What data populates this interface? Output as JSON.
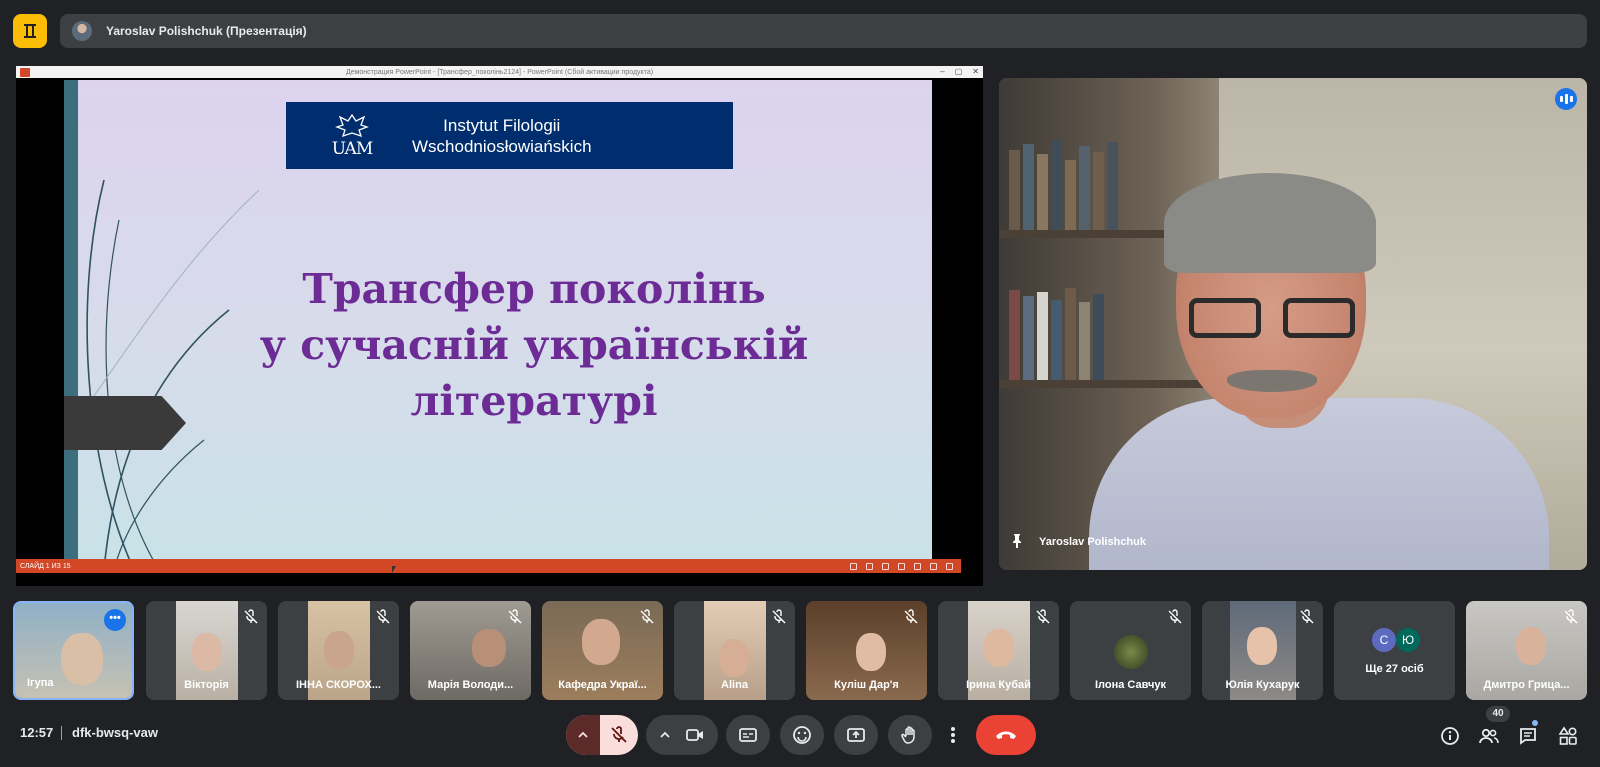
{
  "topbar": {
    "presenter_title": "Yaroslav Polishchuk (Презентація)"
  },
  "presentation": {
    "window_title": "Демонстрация PowerPoint - [Трансфер_поколінь2124] - PowerPoint (Сбой активации продукта)",
    "banner": {
      "logo_text": "UAM",
      "line1": "Instytut Filologii",
      "line2": "Wschodniosłowiańskich"
    },
    "slide_title_lines": [
      "Трансфер поколінь",
      "у сучасній українській",
      "літературі"
    ],
    "status": "СЛАЙД 1 ИЗ 15"
  },
  "speaker": {
    "name": "Yaroslav Polishchuk"
  },
  "participants": [
    {
      "name": "Ігупа"
    },
    {
      "name": "Вікторія"
    },
    {
      "name": "ІННА СКОРОХ..."
    },
    {
      "name": "Марія Володи..."
    },
    {
      "name": "Кафедра Украї..."
    },
    {
      "name": "Alina"
    },
    {
      "name": "Куліш Дар'я"
    },
    {
      "name": "Ірина Кубай"
    },
    {
      "name": "Ілона Савчук"
    },
    {
      "name": "Юлія Кухарук"
    },
    {
      "name": "Ще 27 осіб",
      "avatars": [
        "С",
        "Ю"
      ]
    },
    {
      "name": "Дмитро Грица..."
    }
  ],
  "bottom": {
    "time": "12:57",
    "meeting_code": "dfk-bwsq-vaw",
    "people_count": "40"
  },
  "colors": {
    "background": "#202124",
    "end_call": "#ea4335",
    "mic_off": "#f9dedc",
    "accent": "#1a73e8",
    "slide_title": "#6c2b95"
  },
  "icons": [
    "meet-logo-icon",
    "mic-off-icon",
    "camera-icon",
    "captions-icon",
    "emoji-icon",
    "present-icon",
    "raise-hand-icon",
    "more-options-icon",
    "end-call-icon",
    "info-icon",
    "people-icon",
    "chat-icon",
    "activities-icon",
    "pin-icon",
    "audio-indicator-icon"
  ]
}
